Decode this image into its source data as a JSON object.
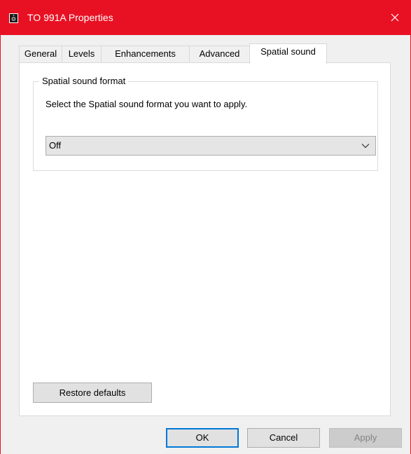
{
  "window": {
    "title": "TO 991A Properties",
    "accent_color": "#e81123",
    "title_icon": "speaker-icon",
    "close_icon": "close-icon"
  },
  "tabs": [
    {
      "label": "General",
      "active": false
    },
    {
      "label": "Levels",
      "active": false
    },
    {
      "label": "Enhancements",
      "active": false
    },
    {
      "label": "Advanced",
      "active": false
    },
    {
      "label": "Spatial sound",
      "active": true
    }
  ],
  "spatial": {
    "group_label": "Spatial sound format",
    "description": "Select the Spatial sound format you want to apply.",
    "format_select": {
      "value": "Off",
      "icon": "chevron-down-icon"
    }
  },
  "restore_defaults_label": "Restore defaults",
  "footer": {
    "ok_label": "OK",
    "cancel_label": "Cancel",
    "apply_label": "Apply",
    "apply_enabled": false
  }
}
